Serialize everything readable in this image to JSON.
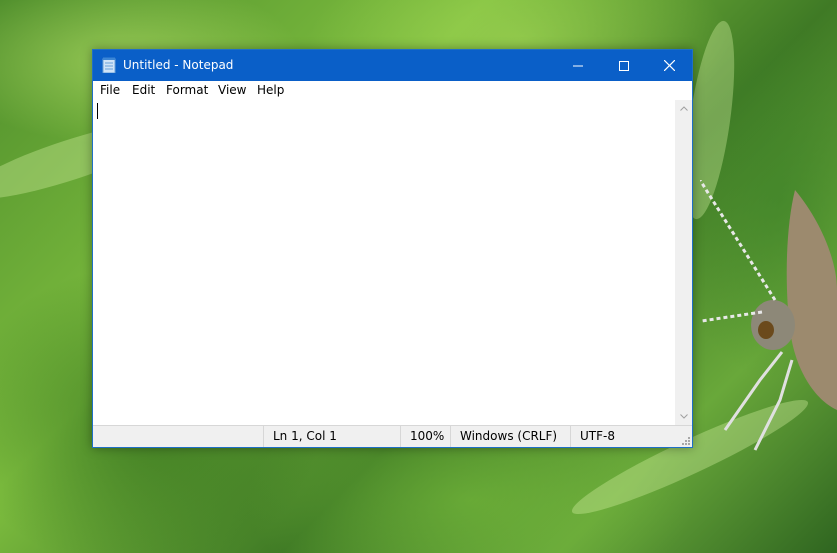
{
  "window": {
    "title": "Untitled - Notepad",
    "icon": "notepad-icon",
    "controls": [
      "minimize-icon",
      "maximize-icon",
      "close-icon"
    ]
  },
  "menu": {
    "items": [
      "File",
      "Edit",
      "Format",
      "View",
      "Help"
    ]
  },
  "editor": {
    "content": ""
  },
  "status": {
    "position": "Ln 1, Col 1",
    "zoom": "100%",
    "line_ending": "Windows (CRLF)",
    "encoding": "UTF-8"
  },
  "colors": {
    "titlebar": "#0a5fc8",
    "statusbar": "#f0f0f0",
    "editor_background": "#ffffff"
  }
}
